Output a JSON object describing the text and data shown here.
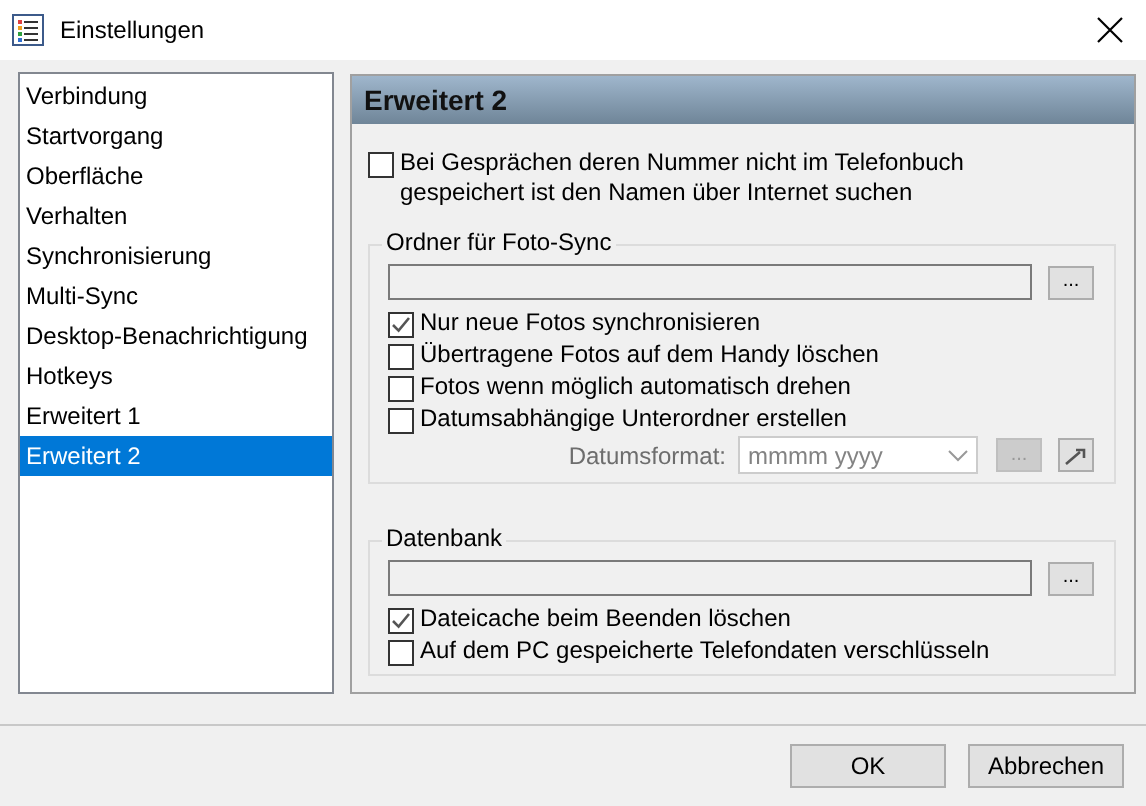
{
  "window": {
    "title": "Einstellungen"
  },
  "sidebar": {
    "items": [
      {
        "label": "Verbindung",
        "selected": false
      },
      {
        "label": "Startvorgang",
        "selected": false
      },
      {
        "label": "Oberfläche",
        "selected": false
      },
      {
        "label": "Verhalten",
        "selected": false
      },
      {
        "label": "Synchronisierung",
        "selected": false
      },
      {
        "label": "Multi-Sync",
        "selected": false
      },
      {
        "label": "Desktop-Benachrichtigung",
        "selected": false
      },
      {
        "label": "Hotkeys",
        "selected": false
      },
      {
        "label": "Erweitert 1",
        "selected": false
      },
      {
        "label": "Erweitert 2",
        "selected": true
      }
    ]
  },
  "panel": {
    "title": "Erweitert 2",
    "option": {
      "label": "Bei Gesprächen deren Nummer nicht im Telefonbuch gespeichert ist den Namen über Internet suchen",
      "checked": false
    },
    "groups": [
      {
        "title": "Ordner für Foto-Sync",
        "browse": "...",
        "checkboxes": [
          {
            "label": "Nur neue Fotos synchronisieren",
            "checked": true
          },
          {
            "label": "Übertragene Fotos auf dem Handy löschen",
            "checked": false
          },
          {
            "label": "Fotos wenn möglich automatisch drehen",
            "checked": false
          },
          {
            "label": "Datumsabhängige Unterordner erstellen",
            "checked": false
          }
        ],
        "date_format": {
          "label": "Datumsformat:",
          "value": "mmmm yyyy",
          "browse": "...",
          "disabled": true
        }
      },
      {
        "title": "Datenbank",
        "browse": "...",
        "checkboxes": [
          {
            "label": "Dateicache beim Beenden löschen",
            "checked": true
          },
          {
            "label": "Auf dem PC gespeicherte Telefondaten verschlüsseln",
            "checked": false
          }
        ]
      }
    ]
  },
  "buttons": [
    {
      "label": "OK"
    },
    {
      "label": "Abbrechen"
    }
  ]
}
